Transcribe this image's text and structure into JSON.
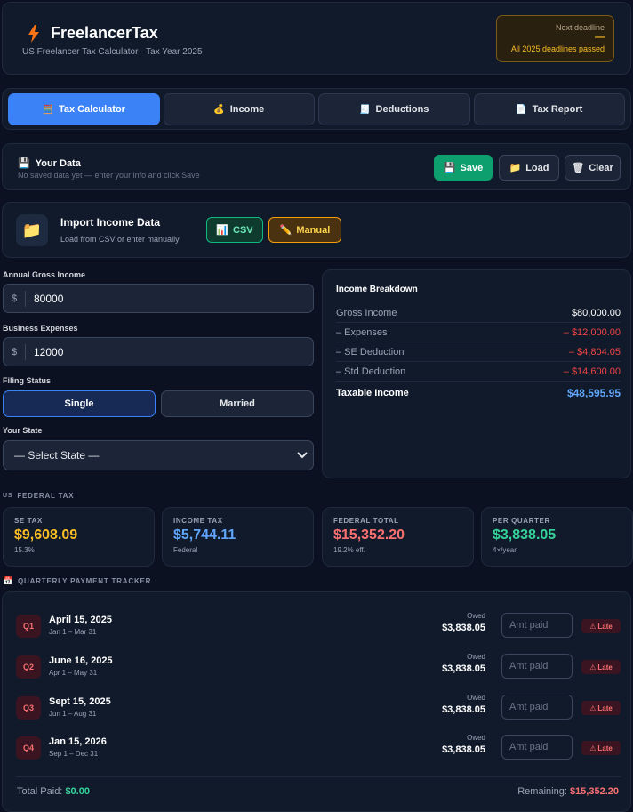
{
  "header": {
    "app_name": "FreelancerTax",
    "subtitle": "US Freelancer Tax Calculator · Tax Year 2025",
    "deadline_label": "Next deadline",
    "deadline_value": "—",
    "deadline_note": "All 2025 deadlines passed"
  },
  "tabs": [
    {
      "icon": "🧮",
      "label": "Tax Calculator"
    },
    {
      "icon": "💰",
      "label": "Income"
    },
    {
      "icon": "🧾",
      "label": "Deductions"
    },
    {
      "icon": "📄",
      "label": "Tax Report"
    }
  ],
  "your_data": {
    "icon": "💾",
    "title": "Your Data",
    "subtitle": "No saved data yet — enter your info and click Save",
    "save_icon": "💾",
    "save_label": "Save",
    "load_icon": "📁",
    "load_label": "Load",
    "clear_icon": "🗑",
    "clear_label": "Clear"
  },
  "import": {
    "icon": "📁",
    "title": "Import Income Data",
    "subtitle": "Load from CSV or enter manually",
    "csv_icon": "📊",
    "csv_label": "CSV",
    "manual_icon": "✏️",
    "manual_label": "Manual"
  },
  "form": {
    "gross_label": "Annual Gross Income",
    "gross_currency": "$",
    "gross_value": "80000",
    "expenses_label": "Business Expenses",
    "expenses_currency": "$",
    "expenses_value": "12000",
    "filing_label": "Filing Status",
    "filing_single": "Single",
    "filing_married": "Married",
    "state_label": "Your State",
    "state_value": "— Select State —"
  },
  "breakdown": {
    "title": "Income Breakdown",
    "rows": [
      {
        "label": "Gross Income",
        "value": "$80,000.00"
      },
      {
        "label": "– Expenses",
        "value": "– $12,000.00"
      },
      {
        "label": "– SE Deduction",
        "value": "– $4,804.05"
      },
      {
        "label": "– Std Deduction",
        "value": "– $14,600.00"
      }
    ],
    "total_label": "Taxable Income",
    "total_value": "$48,595.95"
  },
  "federal": {
    "flag": "US",
    "heading": "FEDERAL TAX",
    "cards": [
      {
        "label": "SE TAX",
        "value": "$9,608.09",
        "sub": "15.3%",
        "color": "#fbbf24"
      },
      {
        "label": "INCOME TAX",
        "value": "$5,744.11",
        "sub": "Federal",
        "color": "#60a5fa"
      },
      {
        "label": "FEDERAL TOTAL",
        "value": "$15,352.20",
        "sub": "19.2% eff.",
        "color": "#f87171"
      },
      {
        "label": "PER QUARTER",
        "value": "$3,838.05",
        "sub": "4×/year",
        "color": "#34d399"
      }
    ]
  },
  "quarterly": {
    "icon": "📅",
    "heading": "QUARTERLY PAYMENT TRACKER",
    "rows": [
      {
        "q": "Q1",
        "date": "April 15, 2025",
        "range": "Jan 1 – Mar 31",
        "owed_label": "Owed",
        "owed": "$3,838.05",
        "placeholder": "Amt paid",
        "status": "Late"
      },
      {
        "q": "Q2",
        "date": "June 16, 2025",
        "range": "Apr 1 – May 31",
        "owed_label": "Owed",
        "owed": "$3,838.05",
        "placeholder": "Amt paid",
        "status": "Late"
      },
      {
        "q": "Q3",
        "date": "Sept 15, 2025",
        "range": "Jun 1 – Aug 31",
        "owed_label": "Owed",
        "owed": "$3,838.05",
        "placeholder": "Amt paid",
        "status": "Late"
      },
      {
        "q": "Q4",
        "date": "Jan 15, 2026",
        "range": "Sep 1 – Dec 31",
        "owed_label": "Owed",
        "owed": "$3,838.05",
        "placeholder": "Amt paid",
        "status": "Late"
      }
    ],
    "total_paid_label": "Total Paid:",
    "total_paid_value": "$0.00",
    "remaining_label": "Remaining:",
    "remaining_value": "$15,352.20"
  }
}
